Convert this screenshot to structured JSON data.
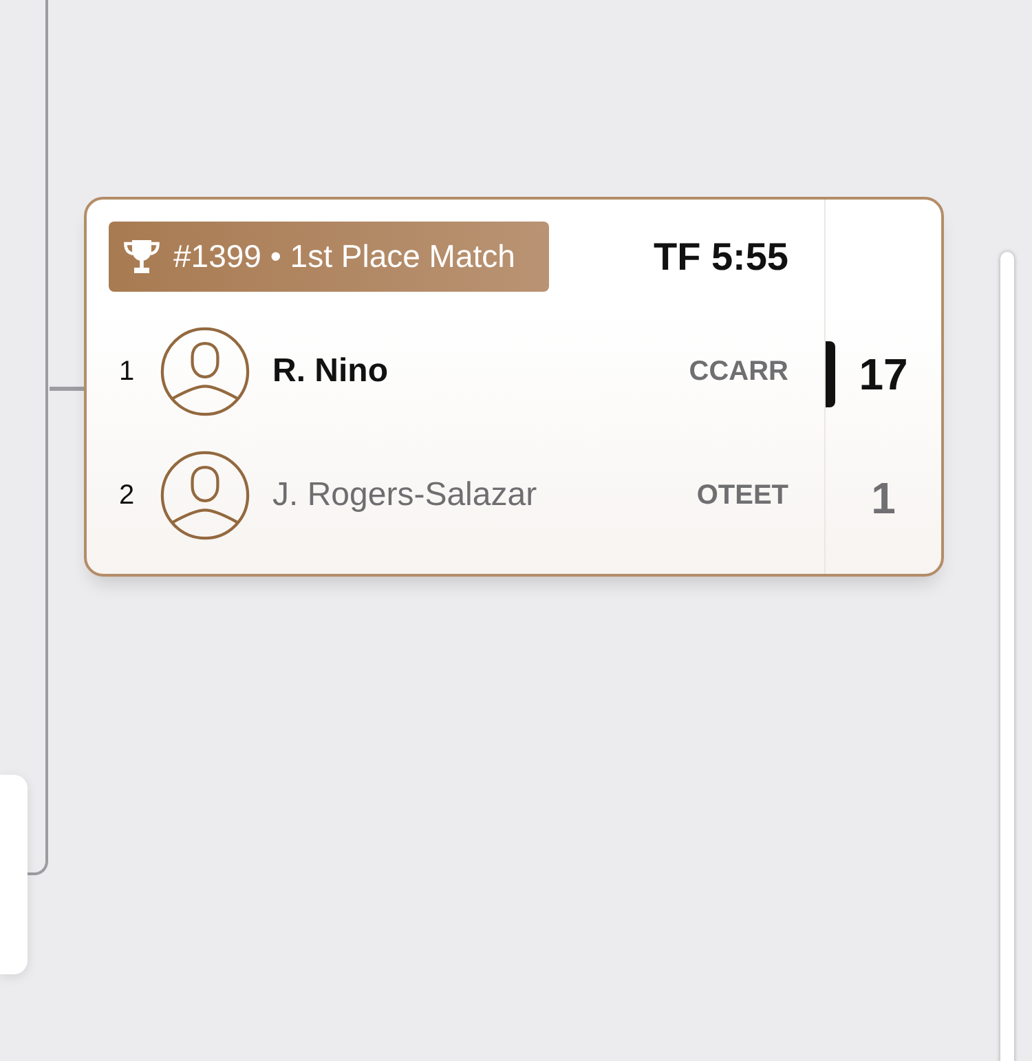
{
  "match": {
    "title": "#1399 • 1st Place Match",
    "result": "TF 5:55",
    "competitors": [
      {
        "seed": "1",
        "name": "R. Nino",
        "team": "CCARR",
        "score": "17",
        "winner": true
      },
      {
        "seed": "2",
        "name": "J. Rogers-Salazar",
        "team": "OTEET",
        "score": "1",
        "winner": false
      }
    ]
  }
}
